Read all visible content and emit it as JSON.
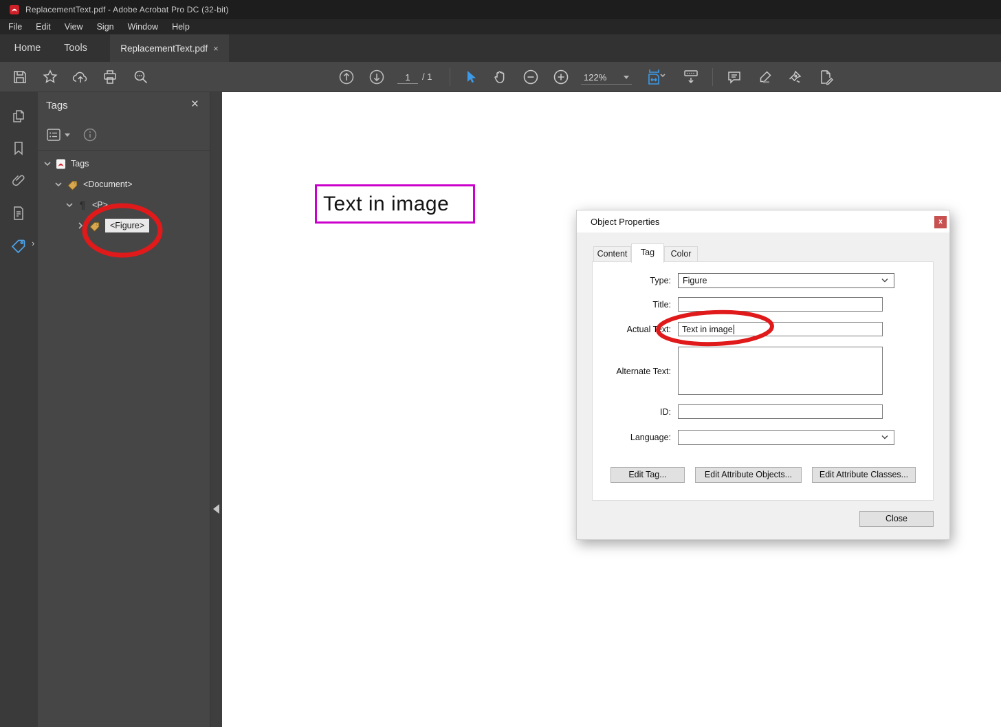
{
  "app": {
    "title": "ReplacementText.pdf - Adobe Acrobat Pro DC (32-bit)",
    "menu": [
      "File",
      "Edit",
      "View",
      "Sign",
      "Window",
      "Help"
    ],
    "tabs": {
      "home": "Home",
      "tools": "Tools",
      "document": "ReplacementText.pdf",
      "close": "×"
    }
  },
  "toolbar": {
    "page_current": "1",
    "page_total": "/ 1",
    "zoom_level": "122%"
  },
  "tags_panel": {
    "title": "Tags",
    "close": "×",
    "tree": [
      {
        "label": "Tags",
        "icon": "acrobat-tags-root-icon"
      },
      {
        "label": "<Document>",
        "icon": "tag-icon"
      },
      {
        "label": "<P>",
        "icon": "paragraph-icon"
      },
      {
        "label": "<Figure>",
        "icon": "tag-icon",
        "selected": true
      }
    ],
    "paragraph_glyph": "¶"
  },
  "document": {
    "figure_text": "Text in image"
  },
  "dialog": {
    "title": "Object Properties",
    "close": "x",
    "tabs": [
      {
        "label": "Content"
      },
      {
        "label": "Tag"
      },
      {
        "label": "Color"
      }
    ],
    "active_tab": "Tag",
    "fields": {
      "type": {
        "label": "Type:",
        "value": "Figure"
      },
      "title": {
        "label": "Title:",
        "value": ""
      },
      "actual_text": {
        "label": "Actual Text:",
        "value": "Text in image"
      },
      "alternate_text": {
        "label": "Alternate Text:",
        "value": ""
      },
      "id": {
        "label": "ID:",
        "value": ""
      },
      "language": {
        "label": "Language:",
        "value": ""
      }
    },
    "buttons": {
      "edit_tag": "Edit Tag...",
      "edit_attribute_objects": "Edit Attribute Objects...",
      "edit_attribute_classes": "Edit Attribute Classes...",
      "close": "Close"
    }
  },
  "colors": {
    "accent_blue": "#3d9ae8",
    "annotation_red": "#e01a1a",
    "figure_highlight_magenta": "#cc00cc",
    "dialog_close_red": "#c75050",
    "tag_gold": "#d9a84e"
  }
}
